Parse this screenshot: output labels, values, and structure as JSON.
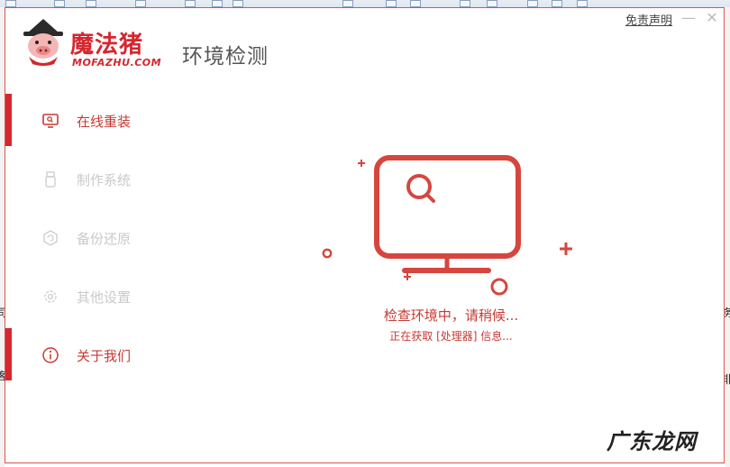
{
  "app": {
    "brand_name": "魔法猪",
    "brand_domain": "MOFAZHU.COM",
    "window_title": "环境检测",
    "disclaimer_link": "免责声明",
    "minimize_glyph": "—",
    "close_glyph": "✕"
  },
  "sidebar": {
    "items": [
      {
        "label": "在线重装",
        "icon": "monitor-icon",
        "active": true
      },
      {
        "label": "制作系统",
        "icon": "usb-icon",
        "active": false
      },
      {
        "label": "备份还原",
        "icon": "backup-icon",
        "active": false
      },
      {
        "label": "其他设置",
        "icon": "gear-icon",
        "active": false
      },
      {
        "label": "关于我们",
        "icon": "info-icon",
        "active": true
      }
    ]
  },
  "main": {
    "status_main": "检查环境中，请稍候...",
    "status_sub": "正在获取 [处理器] 信息..."
  },
  "background": {
    "edge_left_1": "司",
    "edge_left_2": "客",
    "edge_right_1": "务",
    "edge_right_2": "非"
  },
  "watermark": "广东龙网",
  "colors": {
    "accent": "#d6262f",
    "accent_text": "#c53a34",
    "inactive_text": "#c9c9c9"
  }
}
